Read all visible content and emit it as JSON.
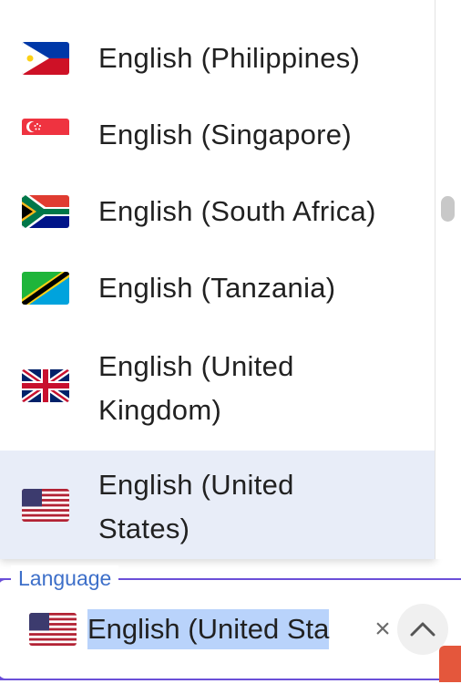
{
  "language_dropdown": {
    "options": [
      {
        "label": "English (Philippines)",
        "flag": "flag-philippines"
      },
      {
        "label": "English (Singapore)",
        "flag": "flag-singapore"
      },
      {
        "label": "English (South Africa)",
        "flag": "flag-south-africa"
      },
      {
        "label": "English (Tanzania)",
        "flag": "flag-tanzania"
      },
      {
        "label": "English (United\nKingdom)",
        "flag": "flag-united-kingdom"
      },
      {
        "label": "English (United\nStates)",
        "flag": "flag-united-states",
        "selected": true
      }
    ]
  },
  "language_field": {
    "label": "Language",
    "value": "English (United Sta",
    "flag": "flag-united-states",
    "clear_icon": "×"
  },
  "colors": {
    "accent": "#6b4fd8",
    "label": "#3d6fc9",
    "selected_bg": "#e8edf8",
    "text_highlight": "#b9d3fb"
  }
}
